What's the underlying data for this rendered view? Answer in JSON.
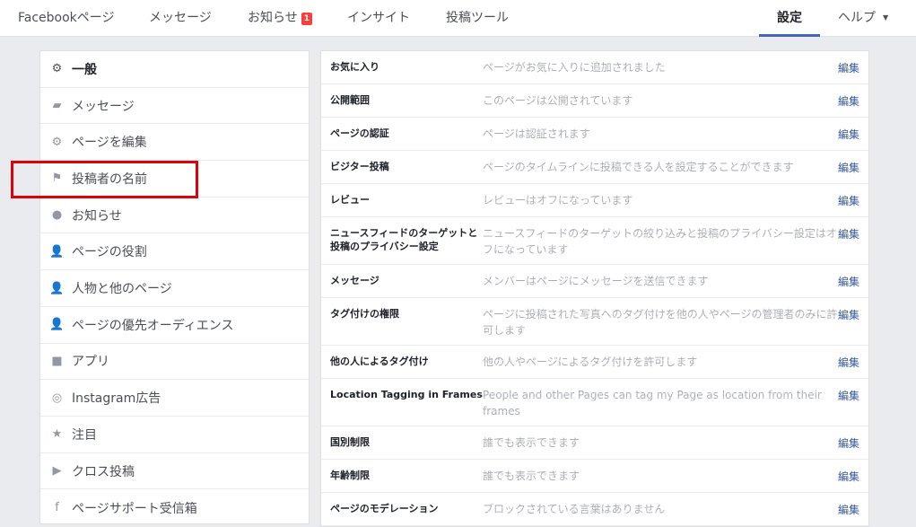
{
  "topnav": {
    "page": "Facebookページ",
    "messages": "メッセージ",
    "notifications": "お知らせ",
    "notifications_badge": "1",
    "insights": "インサイト",
    "publishing_tools": "投稿ツール",
    "settings": "設定",
    "help": "ヘルプ"
  },
  "sidebar": {
    "items": [
      {
        "label": "一般",
        "icon": "gear-icon"
      },
      {
        "label": "メッセージ",
        "icon": "message-icon"
      },
      {
        "label": "ページを編集",
        "icon": "gear-icon"
      },
      {
        "label": "投稿者の名前",
        "icon": "flag-icon"
      },
      {
        "label": "お知らせ",
        "icon": "globe-icon"
      },
      {
        "label": "ページの役割",
        "icon": "person-icon"
      },
      {
        "label": "人物と他のページ",
        "icon": "person-plus-icon"
      },
      {
        "label": "ページの優先オーディエンス",
        "icon": "person-plus-icon"
      },
      {
        "label": "アプリ",
        "icon": "cube-icon"
      },
      {
        "label": "Instagram広告",
        "icon": "instagram-icon"
      },
      {
        "label": "注目",
        "icon": "star-icon"
      },
      {
        "label": "クロス投稿",
        "icon": "video-icon"
      },
      {
        "label": "ページサポート受信箱",
        "icon": "facebook-icon"
      }
    ]
  },
  "settings": {
    "edit_label": "編集",
    "rows": [
      {
        "label": "お気に入り",
        "value": "ページがお気に入りに追加されました"
      },
      {
        "label": "公開範囲",
        "value": "このページは公開されています"
      },
      {
        "label": "ページの認証",
        "value": "ページは認証されます"
      },
      {
        "label": "ビジター投稿",
        "value": "ページのタイムラインに投稿できる人を設定することができます"
      },
      {
        "label": "レビュー",
        "value": "レビューはオフになっています"
      },
      {
        "label": "ニュースフィードのターゲットと投稿のプライバシー設定",
        "value": "ニュースフィードのターゲットの絞り込みと投稿のプライバシー設定はオフになっています"
      },
      {
        "label": "メッセージ",
        "value": "メンバーはページにメッセージを送信できます"
      },
      {
        "label": "タグ付けの権限",
        "value": "ページに投稿された写真へのタグ付けを他の人やページの管理者のみに許可します"
      },
      {
        "label": "他の人によるタグ付け",
        "value": "他の人やページによるタグ付けを許可します"
      },
      {
        "label": "Location Tagging in Frames",
        "value": "People and other Pages can tag my Page as location from their frames"
      },
      {
        "label": "国別制限",
        "value": "誰でも表示できます"
      },
      {
        "label": "年齢制限",
        "value": "誰でも表示できます"
      },
      {
        "label": "ページのモデレーション",
        "value": "ブロックされている言葉はありません"
      }
    ]
  }
}
